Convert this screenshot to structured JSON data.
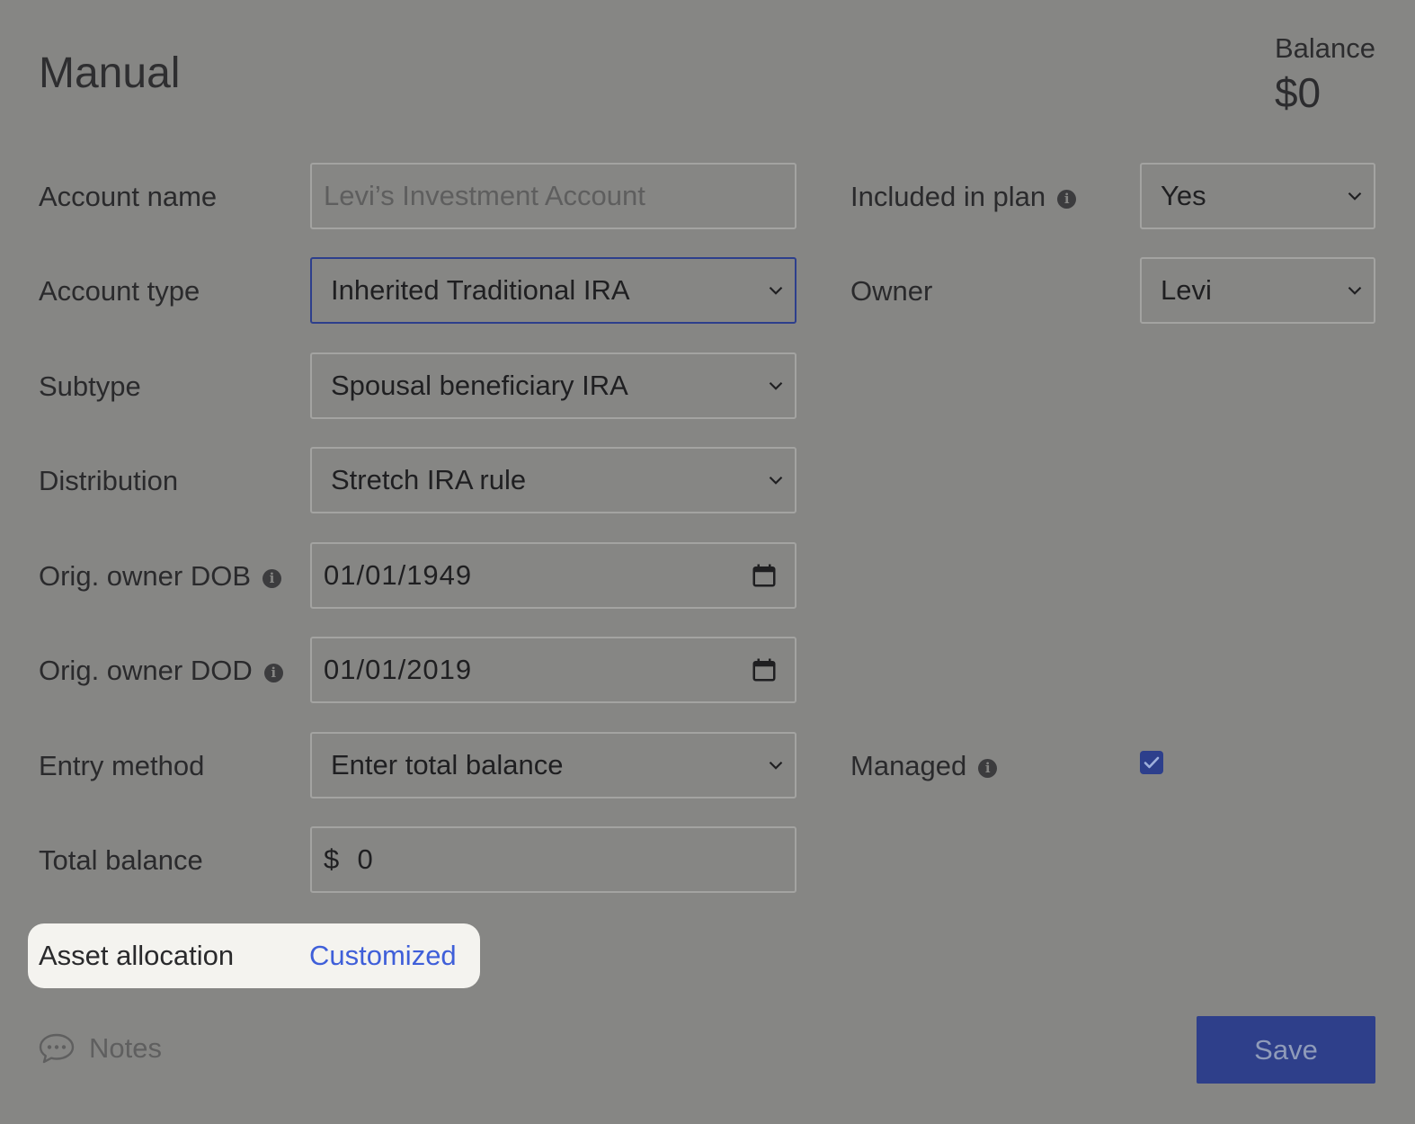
{
  "header": {
    "title": "Manual",
    "balance_label": "Balance",
    "balance_value": "$0"
  },
  "form": {
    "account_name": {
      "label": "Account name",
      "placeholder": "Levi’s Investment Account"
    },
    "account_type": {
      "label": "Account type",
      "value": "Inherited Traditional IRA"
    },
    "subtype": {
      "label": "Subtype",
      "value": "Spousal beneficiary IRA"
    },
    "distribution": {
      "label": "Distribution",
      "value": "Stretch IRA rule"
    },
    "orig_owner_dob": {
      "label": "Orig. owner DOB",
      "value": "01/01/1949"
    },
    "orig_owner_dod": {
      "label": "Orig. owner DOD",
      "value": "01/01/2019"
    },
    "entry_method": {
      "label": "Entry method",
      "value": "Enter total balance"
    },
    "total_balance": {
      "label": "Total balance",
      "value": "$  0"
    },
    "included_in_plan": {
      "label": "Included in plan",
      "value": "Yes"
    },
    "owner": {
      "label": "Owner",
      "value": "Levi"
    },
    "managed": {
      "label": "Managed",
      "checked": true
    },
    "asset_allocation": {
      "label": "Asset allocation",
      "value": "Customized"
    }
  },
  "footer": {
    "notes_label": "Notes",
    "save_label": "Save"
  },
  "icons": {
    "info": "info-icon",
    "chevron": "chevron-down-icon",
    "calendar": "calendar-icon",
    "notes": "speech-bubble-icon"
  },
  "colors": {
    "background": "#868684",
    "accent": "#2e3f8a",
    "link": "#3f5fd9",
    "highlight": "#f4f3ef"
  }
}
